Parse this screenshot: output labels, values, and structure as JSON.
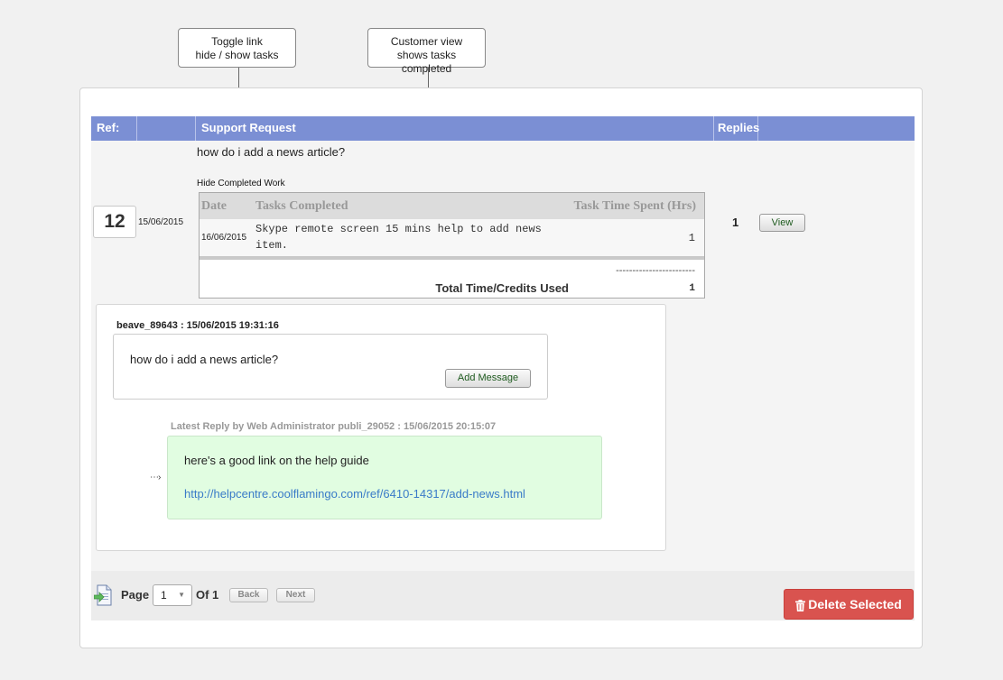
{
  "callouts": {
    "toggle_line1": "Toggle link",
    "toggle_line2": "hide / show tasks",
    "customer_line1": "Customer view",
    "customer_line2": "shows tasks completed"
  },
  "table": {
    "col_ref": "Ref:",
    "col_support": "Support Request",
    "col_replies": "Replies"
  },
  "request": {
    "question": "how do i add a news article?",
    "hide_link": "Hide Completed Work",
    "ref": "12",
    "date": "15/06/2015",
    "replies": "1",
    "view_button": "View"
  },
  "tasks": {
    "col_date": "Date",
    "col_tasks": "Tasks Completed",
    "col_time": "Task Time Spent (Hrs)",
    "rows": [
      {
        "date": "16/06/2015",
        "line1": "Skype remote screen 15 mins help to add news",
        "line2": "item.",
        "time": "1"
      }
    ],
    "dashes": "------------------------",
    "total_label": "Total Time/Credits Used",
    "total_value": "1"
  },
  "message": {
    "author": "beave_89643 : 15/06/2015 19:31:16",
    "text": "how do i add a news article?",
    "add_button": "Add Message"
  },
  "reply": {
    "author": "Latest Reply by Web Administrator  publi_29052 : 15/06/2015 20:15:07",
    "text": "here's a good link on the help guide",
    "link": "http://helpcentre.coolflamingo.com/ref/6410-14317/add-news.html"
  },
  "pager": {
    "page_label": "Page",
    "page_value": "1",
    "of_label": "Of 1",
    "back": "Back",
    "next": "Next",
    "delete": "Delete Selected"
  }
}
